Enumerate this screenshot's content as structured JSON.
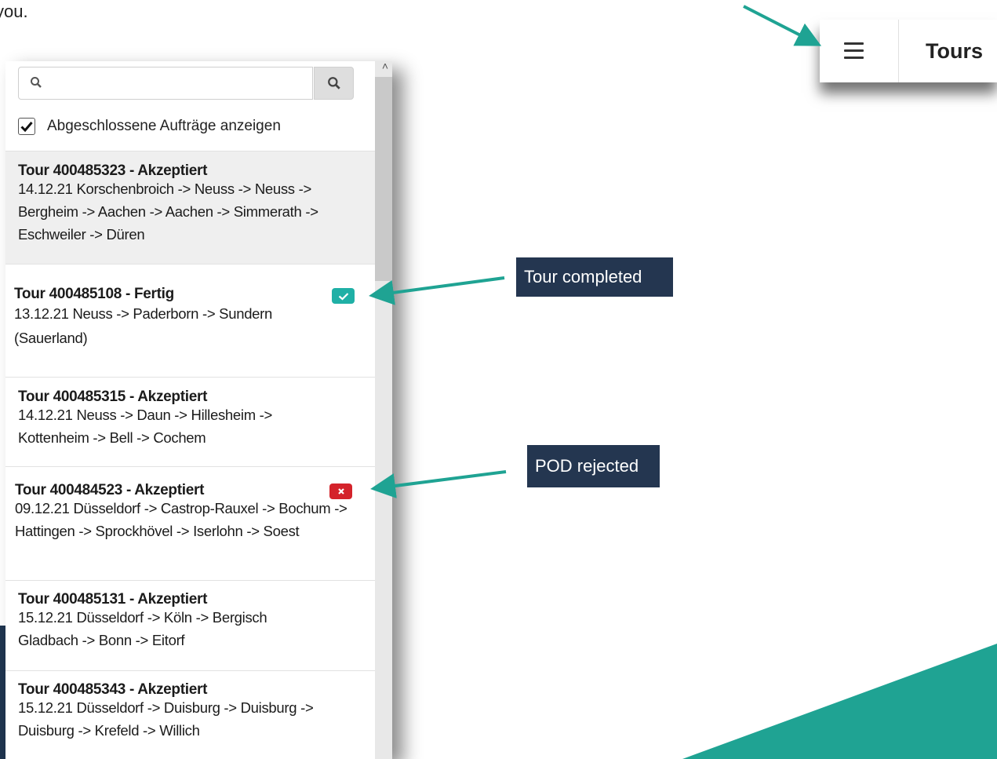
{
  "intro_text": "you.",
  "search": {
    "placeholder": "",
    "value": ""
  },
  "show_completed": {
    "label": "Abgeschlossene Aufträge anzeigen",
    "checked": true
  },
  "tours": [
    {
      "title": "Tour 400485323 - Akzeptiert",
      "details": "14.12.21 Korschenbroich -> Neuss -> Neuss -> Bergheim -> Aachen -> Aachen -> Simmerath -> Eschweiler -> Düren",
      "selected": true,
      "status_badge": null
    },
    {
      "title": "Tour 400485108 - Fertig",
      "details": "13.12.21 Neuss -> Paderborn -> Sundern (Sauerland)",
      "selected": false,
      "status_badge": "completed"
    },
    {
      "title": "Tour 400485315 - Akzeptiert",
      "details": "14.12.21 Neuss -> Daun -> Hillesheim -> Kottenheim -> Bell -> Cochem",
      "selected": false,
      "status_badge": null
    },
    {
      "title": "Tour 400484523 - Akzeptiert",
      "details": "09.12.21 Düsseldorf -> Castrop-Rauxel -> Bochum -> Hattingen -> Sprockhövel -> Iserlohn -> Soest",
      "selected": false,
      "status_badge": "rejected"
    },
    {
      "title": "Tour 400485131 - Akzeptiert",
      "details": "15.12.21 Düsseldorf -> Köln -> Bergisch Gladbach -> Bonn -> Eitorf",
      "selected": false,
      "status_badge": null
    },
    {
      "title": "Tour 400485343 - Akzeptiert",
      "details": "15.12.21 Düsseldorf -> Duisburg -> Duisburg -> Duisburg -> Krefeld -> Willich",
      "selected": false,
      "status_badge": null
    }
  ],
  "header": {
    "title": "Tours",
    "menu_icon": "hamburger-icon"
  },
  "callouts": {
    "tour_completed": "Tour completed",
    "pod_rejected": "POD rejected"
  },
  "colors": {
    "teal": "#1fa393",
    "callout_bg": "#243650",
    "badge_ok": "#1fb0a6",
    "badge_rejected": "#d4232b"
  }
}
